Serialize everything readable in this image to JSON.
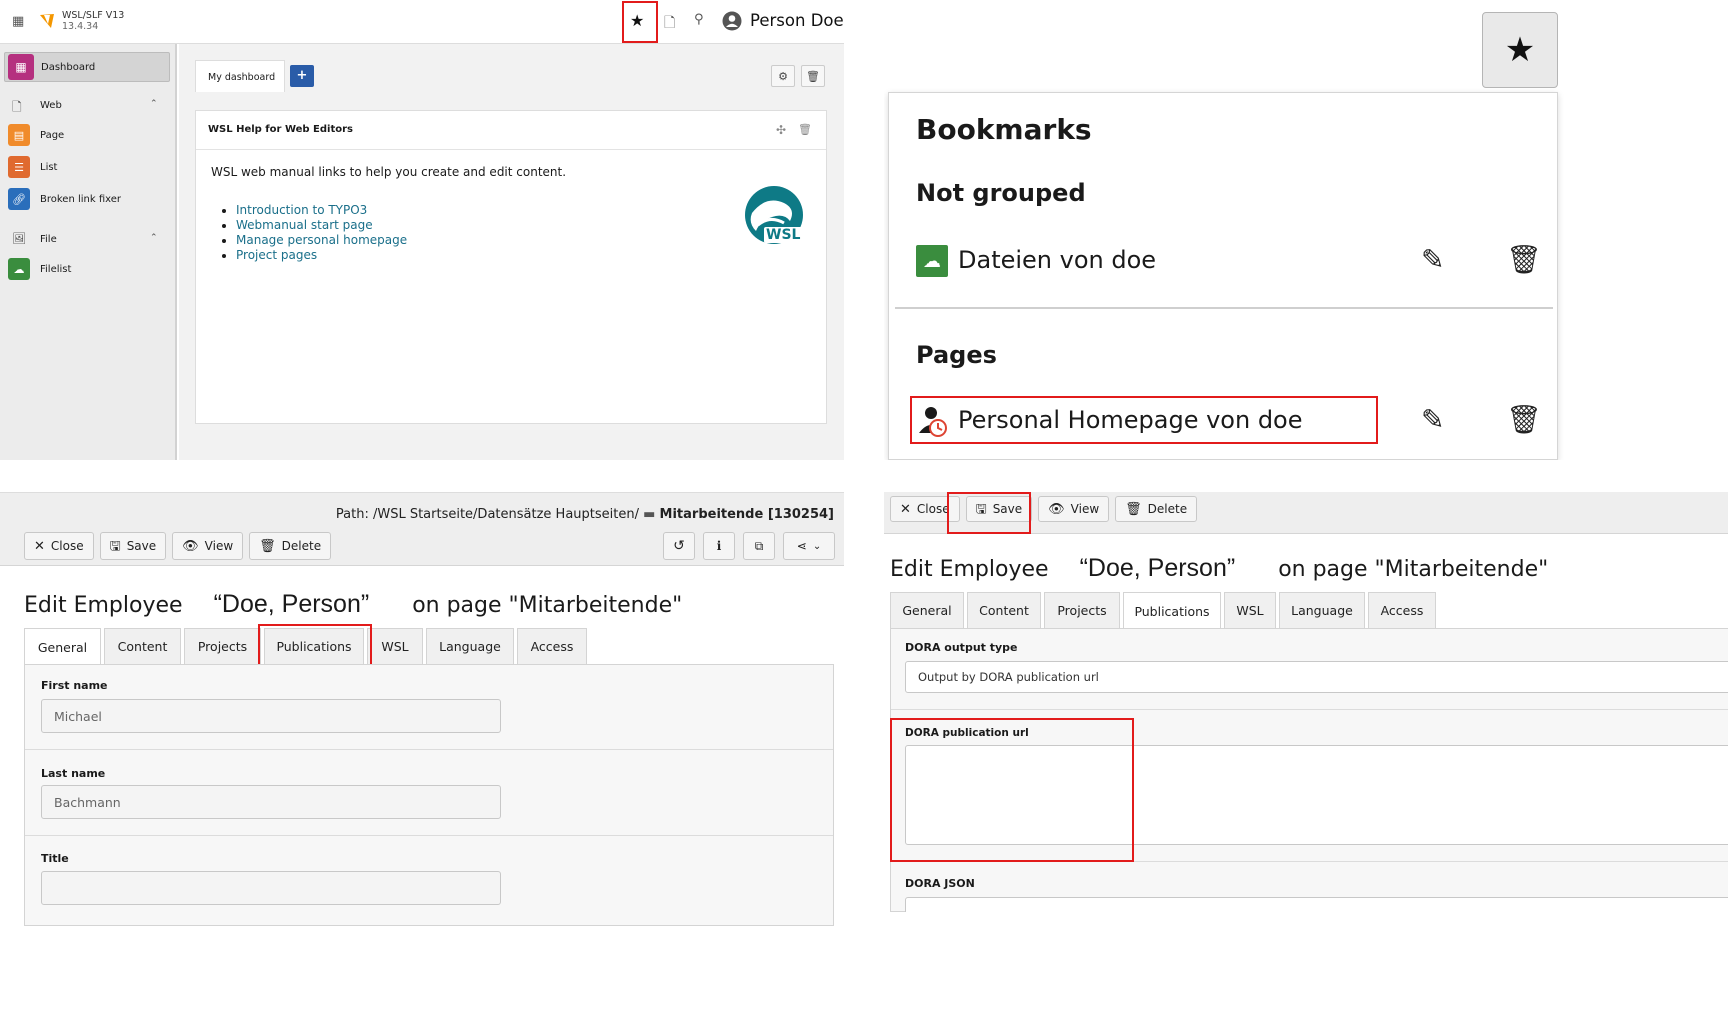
{
  "panel_tl": {
    "app_name": "WSL/SLF V13",
    "app_version": "13.4.34",
    "user_name": "Person Doe",
    "sidebar": {
      "dashboard": "Dashboard",
      "web": "Web",
      "page": "Page",
      "list": "List",
      "broken_link": "Broken link fixer",
      "file": "File",
      "filelist": "Filelist"
    },
    "dashboard_tab": "My dashboard",
    "add_label": "+",
    "widget_title": "WSL Help for Web Editors",
    "widget_intro": "WSL web manual links to help you create and edit content.",
    "links": [
      "Introduction to TYPO3",
      "Webmanual start page",
      "Manage personal homepage",
      "Project pages"
    ],
    "logo_text": "WSL"
  },
  "panel_tr": {
    "heading": "Bookmarks",
    "group1": "Not grouped",
    "item1": "Dateien von doe",
    "group2": "Pages",
    "item2": "Personal Homepage von doe"
  },
  "panel_bl": {
    "path_label": "Path: /WSL Startseite/Datensätze Hauptseiten/",
    "path_current": "Mitarbeitende [130254]",
    "buttons": {
      "close": "Close",
      "save": "Save",
      "view": "View",
      "delete": "Delete"
    },
    "title_prefix": "Edit Employee",
    "title_name": "“Doe, Person”",
    "title_suffix": "on page \"Mitarbeitende\"",
    "tabs": [
      "General",
      "Content",
      "Projects",
      "Publications",
      "WSL",
      "Language",
      "Access"
    ],
    "first_name_label": "First name",
    "first_name_value": "Michael",
    "last_name_label": "Last name",
    "last_name_value": "Bachmann",
    "title_label": "Title",
    "title_value": ""
  },
  "panel_br": {
    "buttons": {
      "close": "Close",
      "save": "Save",
      "view": "View",
      "delete": "Delete"
    },
    "title_prefix": "Edit Employee",
    "title_name": "“Doe, Person”",
    "title_suffix": "on page \"Mitarbeitende\"",
    "tabs": [
      "General",
      "Content",
      "Projects",
      "Publications",
      "WSL",
      "Language",
      "Access"
    ],
    "output_type_label": "DORA output type",
    "output_type_value": "Output by DORA publication url",
    "pub_url_label": "DORA publication url",
    "pub_url_value": "",
    "json_label": "DORA JSON"
  },
  "colors": {
    "highlight": "#e21b1b",
    "dashboard_icon": "#b5307f",
    "page_icon": "#f08b2b",
    "list_icon": "#e06a2f",
    "link_icon": "#2a6ebb",
    "filelist_icon": "#3a8d3e",
    "link_color": "#1a6f8a",
    "wsl_teal": "#0e7a86",
    "add_button": "#2a5ca8"
  }
}
